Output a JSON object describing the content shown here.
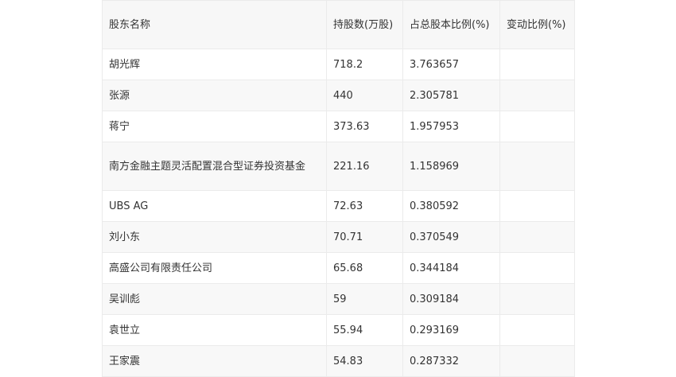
{
  "table": {
    "headers": [
      "股东名称",
      "持股数(万股)",
      "占总股本比例(%)",
      "变动比例(%)"
    ],
    "rows": [
      [
        "胡光辉",
        "718.2",
        "3.763657",
        ""
      ],
      [
        "张源",
        "440",
        "2.305781",
        ""
      ],
      [
        "蒋宁",
        "373.63",
        "1.957953",
        ""
      ],
      [
        "南方金融主题灵活配置混合型证券投资基金",
        "221.16",
        "1.158969",
        ""
      ],
      [
        "UBS AG",
        "72.63",
        "0.380592",
        ""
      ],
      [
        "刘小东",
        "70.71",
        "0.370549",
        ""
      ],
      [
        "高盛公司有限责任公司",
        "65.68",
        "0.344184",
        ""
      ],
      [
        "吴训彪",
        "59",
        "0.309184",
        ""
      ],
      [
        "袁世立",
        "55.94",
        "0.293169",
        ""
      ],
      [
        "王家震",
        "54.83",
        "0.287332",
        ""
      ]
    ]
  }
}
